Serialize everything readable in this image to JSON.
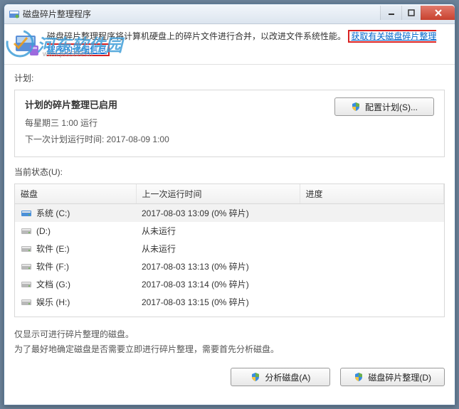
{
  "window": {
    "title": "磁盘碎片整理程序"
  },
  "header": {
    "desc_prefix": "磁盘碎片整理程序将计算机硬盘上的碎片文件进行合并，以改进文件系统性能。",
    "link": "获取有关磁盘碎片整理程序的详细信息"
  },
  "watermark": {
    "name": "河东软件园",
    "url": "www.pc0359.cn"
  },
  "labels": {
    "plan": "计划:",
    "status": "当前状态(U):"
  },
  "plan": {
    "title": "计划的碎片整理已启用",
    "schedule": "每星期三  1:00 运行",
    "next_prefix": "下一次计划运行时间: ",
    "next_time": "2017-08-09 1:00",
    "configure_btn": "配置计划(S)..."
  },
  "table": {
    "cols": {
      "disk": "磁盘",
      "last": "上一次运行时间",
      "progress": "进度"
    },
    "rows": [
      {
        "name": "系统 (C:)",
        "last": "2017-08-03 13:09 (0% 碎片)",
        "sel": true,
        "sys": true
      },
      {
        "name": "(D:)",
        "last": "从未运行"
      },
      {
        "name": "软件 (E:)",
        "last": "从未运行"
      },
      {
        "name": "软件 (F:)",
        "last": "2017-08-03 13:13 (0% 碎片)"
      },
      {
        "name": "文档 (G:)",
        "last": "2017-08-03 13:14 (0% 碎片)"
      },
      {
        "name": "娱乐 (H:)",
        "last": "2017-08-03 13:15 (0% 碎片)"
      }
    ]
  },
  "hint": {
    "line1": "仅显示可进行碎片整理的磁盘。",
    "line2": "为了最好地确定磁盘是否需要立即进行碎片整理，需要首先分析磁盘。"
  },
  "buttons": {
    "analyze": "分析磁盘(A)",
    "defrag": "磁盘碎片整理(D)"
  }
}
